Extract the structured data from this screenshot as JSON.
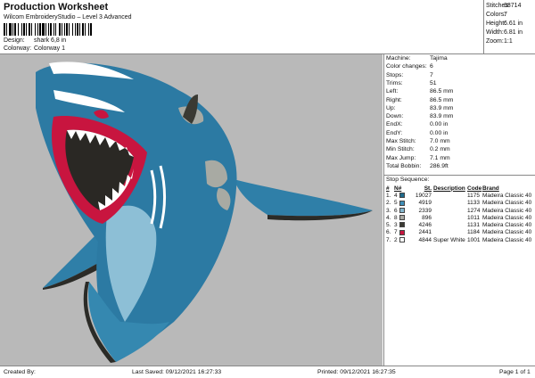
{
  "header": {
    "title": "Production Worksheet",
    "subtitle": "Wilcom EmbroideryStudio – Level 3 Advanced",
    "design_label": "Design:",
    "design_value": "shark 6,8 in",
    "colorway_label": "Colorway:",
    "colorway_value": "Colorway 1"
  },
  "stats": [
    {
      "k": "Stitches:",
      "v": "38714"
    },
    {
      "k": "Colors:",
      "v": "7"
    },
    {
      "k": "Height:",
      "v": "6.61 in"
    },
    {
      "k": "Width:",
      "v": "6.81 in"
    },
    {
      "k": "Zoom:",
      "v": "1:1"
    }
  ],
  "info": [
    {
      "k": "Machine:",
      "v": "Tajima"
    },
    {
      "k": "Color changes:",
      "v": "6"
    },
    {
      "k": "Stops:",
      "v": "7"
    },
    {
      "k": "Trims:",
      "v": "51"
    },
    {
      "k": "Left:",
      "v": "86.5 mm"
    },
    {
      "k": "Right:",
      "v": "86.5 mm"
    },
    {
      "k": "Up:",
      "v": "83.9 mm"
    },
    {
      "k": "Down:",
      "v": "83.9 mm"
    },
    {
      "k": "EndX:",
      "v": "0.00 in"
    },
    {
      "k": "EndY:",
      "v": "0.00 in"
    },
    {
      "k": "Max Stitch:",
      "v": "7.0 mm"
    },
    {
      "k": "Min Stitch:",
      "v": "0.2 mm"
    },
    {
      "k": "Max Jump:",
      "v": "7.1 mm"
    },
    {
      "k": "Total Bobbin:",
      "v": "286.9ft"
    }
  ],
  "sequence": {
    "title": "Stop Sequence:",
    "headers": [
      "#",
      "N#",
      "St.",
      "Description",
      "Code",
      "Brand"
    ],
    "rows": [
      {
        "n": "1.",
        "num": "4",
        "color": "#1f6a8c",
        "st": "19027",
        "desc": "",
        "code": "1175",
        "brand": "Madeira Classic 40"
      },
      {
        "n": "2.",
        "num": "5",
        "color": "#3f8fb8",
        "st": "4919",
        "desc": "",
        "code": "1133",
        "brand": "Madeira Classic 40"
      },
      {
        "n": "3.",
        "num": "6",
        "color": "#84b6cd",
        "st": "2339",
        "desc": "",
        "code": "1274",
        "brand": "Madeira Classic 40"
      },
      {
        "n": "4.",
        "num": "8",
        "color": "#a9a9a3",
        "st": "896",
        "desc": "",
        "code": "1011",
        "brand": "Madeira Classic 40"
      },
      {
        "n": "5.",
        "num": "3",
        "color": "#3b3a33",
        "st": "4246",
        "desc": "",
        "code": "1131",
        "brand": "Madeira Classic 40"
      },
      {
        "n": "6.",
        "num": "7",
        "color": "#c8153f",
        "st": "2441",
        "desc": "",
        "code": "1184",
        "brand": "Madeira Classic 40"
      },
      {
        "n": "7.",
        "num": "2",
        "color": "#ffffff",
        "st": "4844",
        "desc": "Super White",
        "code": "1001",
        "brand": "Madeira Classic 40"
      }
    ]
  },
  "footer": {
    "created": "Created By:",
    "saved": "Last Saved: 09/12/2021 16:27:33",
    "printed": "Printed: 09/12/2021 16:27:35",
    "page": "Page 1 of 1"
  }
}
